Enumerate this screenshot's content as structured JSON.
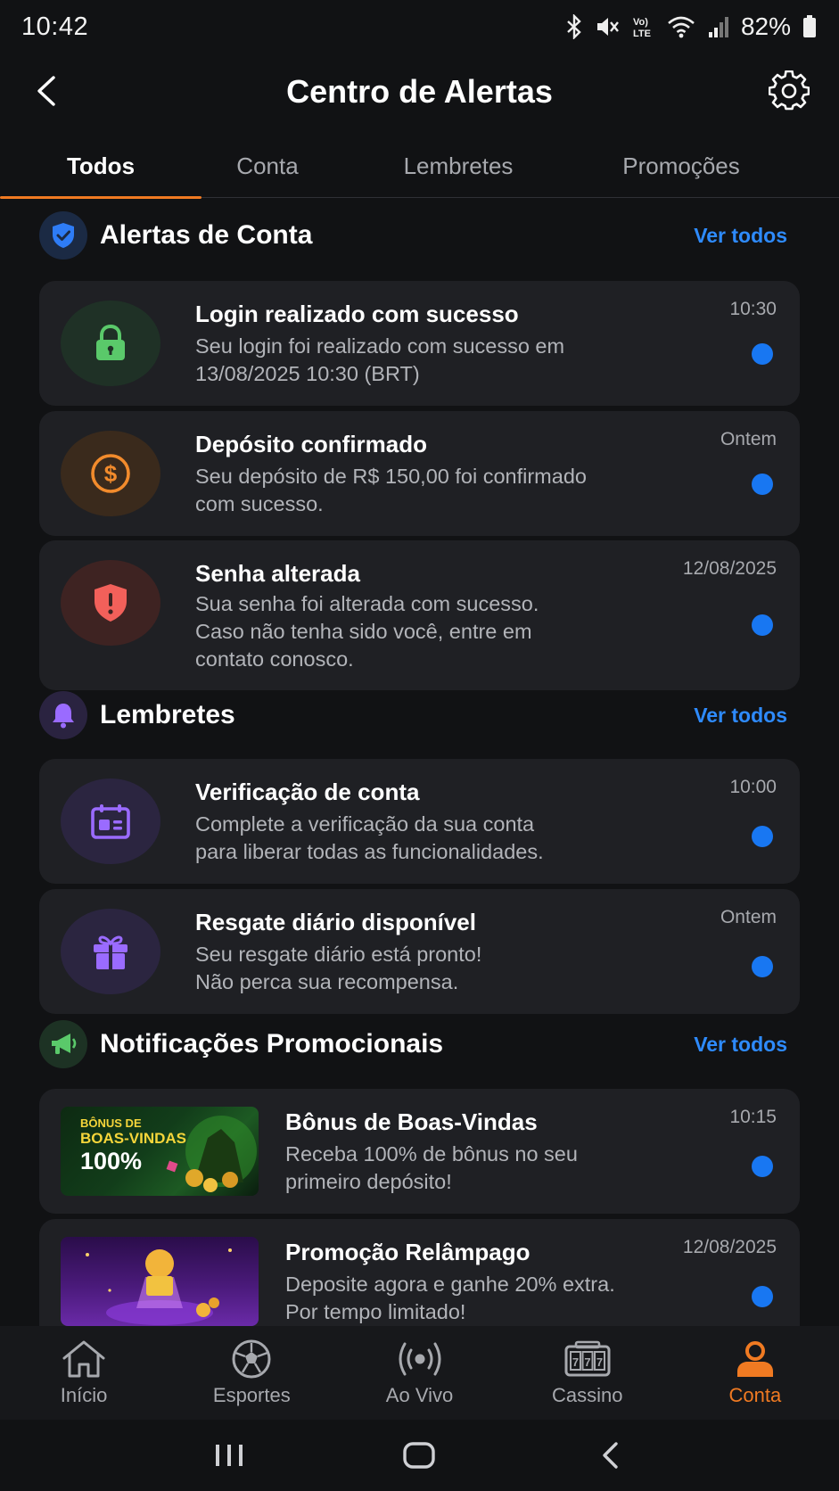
{
  "status_bar": {
    "time": "10:42",
    "battery": "82%",
    "icons": [
      "bluetooth-icon",
      "mute-icon",
      "volte-icon",
      "wifi-icon",
      "signal-icon",
      "battery-icon"
    ]
  },
  "header": {
    "title": "Centro de Alertas",
    "back_icon": "chevron-left-icon",
    "settings_icon": "gear-icon"
  },
  "tabs": [
    {
      "label": "Todos",
      "active": true
    },
    {
      "label": "Conta",
      "active": false
    },
    {
      "label": "Lembretes",
      "active": false
    },
    {
      "label": "Promoções",
      "active": false
    }
  ],
  "sections": {
    "account": {
      "title": "Alertas de Conta",
      "see_all": "Ver todos",
      "icon": "shield-check-icon",
      "items": [
        {
          "title": "Login realizado com sucesso",
          "desc_line1": "Seu login foi realizado com sucesso em",
          "desc_line2": "13/08/2025 10:30 (BRT)",
          "time": "10:30",
          "icon": "lock-icon",
          "unread": true
        },
        {
          "title": "Depósito confirmado",
          "desc_line1": "Seu depósito de R$ 150,00 foi confirmado",
          "desc_line2": "com sucesso.",
          "time": "Ontem",
          "icon": "dollar-coin-icon",
          "unread": true
        },
        {
          "title": "Senha alterada",
          "desc_line1": "Sua senha foi alterada com sucesso.",
          "desc_line2": "Caso não tenha sido você, entre em",
          "desc_line3": "contato conosco.",
          "time": "12/08/2025",
          "icon": "shield-alert-icon",
          "unread": true
        }
      ]
    },
    "reminders": {
      "title": "Lembretes",
      "see_all": "Ver todos",
      "icon": "bell-icon",
      "items": [
        {
          "title": "Verificação de conta",
          "desc_line1": "Complete a verificação da sua conta",
          "desc_line2": "para liberar todas as funcionalidades.",
          "time": "10:00",
          "icon": "id-card-icon",
          "unread": true
        },
        {
          "title": "Resgate diário disponível",
          "desc_line1": "Seu resgate diário está pronto!",
          "desc_line2": "Não perca sua recompensa.",
          "time": "Ontem",
          "icon": "gift-icon",
          "unread": true
        }
      ]
    },
    "promos": {
      "title": "Notificações Promocionais",
      "see_all": "Ver todos",
      "icon": "megaphone-icon",
      "items": [
        {
          "title": "Bônus de Boas-Vindas",
          "desc_line1": "Receba 100% de bônus no seu",
          "desc_line2": "primeiro depósito!",
          "time": "10:15",
          "banner_line1": "BÔNUS DE",
          "banner_line2": "BOAS-VINDAS",
          "banner_line3": "100%",
          "unread": true
        },
        {
          "title": "Promoção Relâmpago",
          "desc_line1": "Deposite agora e ganhe 20% extra.",
          "desc_line2": "Por tempo limitado!",
          "time": "12/08/2025",
          "unread": true
        }
      ]
    }
  },
  "bottom_nav": [
    {
      "label": "Início",
      "icon": "home-icon",
      "active": false
    },
    {
      "label": "Esportes",
      "icon": "soccer-ball-icon",
      "active": false
    },
    {
      "label": "Ao Vivo",
      "icon": "live-broadcast-icon",
      "active": false
    },
    {
      "label": "Cassino",
      "icon": "slot-machine-icon",
      "active": false
    },
    {
      "label": "Conta",
      "icon": "user-icon",
      "active": true
    }
  ],
  "colors": {
    "accent": "#f07a22",
    "link": "#2e8bff",
    "unread_dot": "#1877f2",
    "card_bg": "#1f2024",
    "background": "#111214"
  }
}
